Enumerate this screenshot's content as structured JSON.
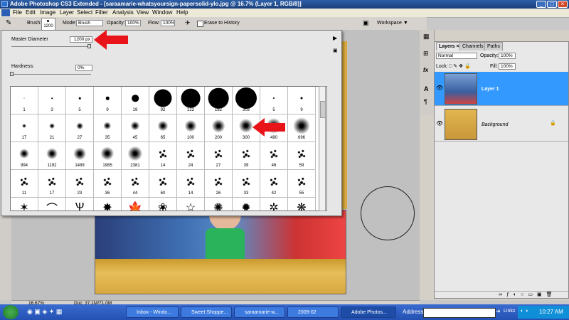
{
  "window": {
    "title": "Adobe Photoshop CS3 Extended - [saraamarie-whatsyoursign-papersolid-ylo.jpg @ 16.7% (Layer 1, RGB/8)]"
  },
  "menu": [
    "File",
    "Edit",
    "Image",
    "Layer",
    "Select",
    "Filter",
    "Analysis",
    "View",
    "Window",
    "Help"
  ],
  "options": {
    "brush_label": "Brush:",
    "brush_size": "1200",
    "mode_label": "Mode:",
    "mode_value": "Brush",
    "opacity_label": "Opacity:",
    "opacity_value": "100%",
    "flow_label": "Flow:",
    "flow_value": "100%",
    "erase_history": "Erase to History",
    "workspace": "Workspace ▼"
  },
  "brush_panel": {
    "master_diameter_label": "Master Diameter",
    "master_diameter_value": "1200 px",
    "hardness_label": "Hardness:",
    "hardness_value": "0%",
    "rows": [
      [
        "1",
        "3",
        "5",
        "9",
        "19",
        "92",
        "122",
        "182",
        "303",
        "5",
        "9"
      ],
      [
        "17",
        "21",
        "27",
        "35",
        "45",
        "65",
        "100",
        "200",
        "300",
        "490",
        "696"
      ],
      [
        "994",
        "1192",
        "1489",
        "1985",
        "2381",
        "14",
        "24",
        "27",
        "39",
        "46",
        "59"
      ],
      [
        "11",
        "17",
        "23",
        "36",
        "44",
        "60",
        "14",
        "26",
        "33",
        "42",
        "55"
      ]
    ]
  },
  "layers_panel": {
    "tabs": [
      "Layers ×",
      "Channels",
      "Paths"
    ],
    "blend_mode": "Normal",
    "opacity_label": "Opacity:",
    "opacity_value": "100%",
    "lock_label": "Lock:",
    "fill_label": "Fill:",
    "fill_value": "100%",
    "layers": [
      {
        "name": "Layer 1",
        "selected": true
      },
      {
        "name": "Background",
        "selected": false
      }
    ]
  },
  "status": {
    "zoom": "16.67%",
    "doc": "Doc: 37.1M/71.0M"
  },
  "taskbar": {
    "items": [
      "Inbox - Windo...",
      "Sweet Shoppe...",
      "saraamarie-w...",
      "2009-02",
      "Adobe Photos..."
    ],
    "address_label": "Address",
    "links_label": "Links",
    "clock": "10:27 AM"
  },
  "colors": {
    "selection": "#3399ff",
    "arrow": "#e8141a",
    "taskbar": "#2451b3"
  }
}
